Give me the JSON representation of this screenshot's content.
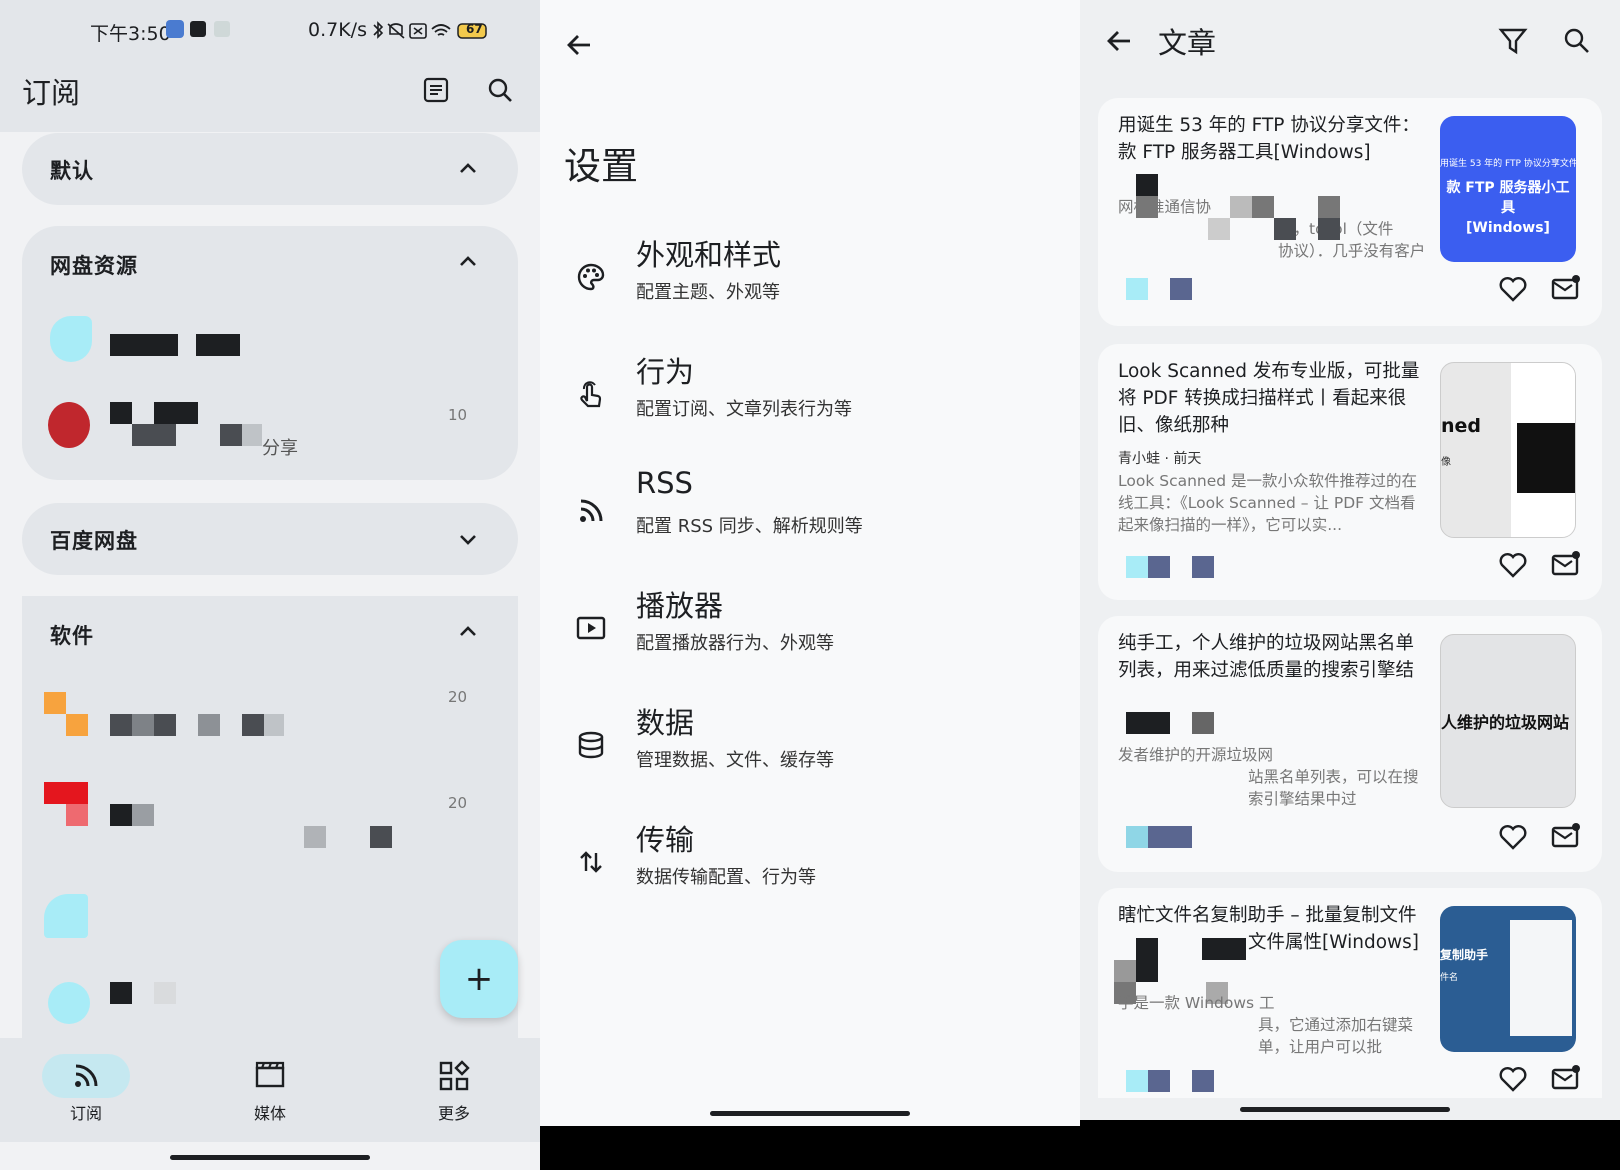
{
  "screen1": {
    "status": {
      "time": "下午3:50",
      "net_speed": "0.7K/s",
      "battery": "67"
    },
    "title": "订阅",
    "groups": [
      {
        "label": "默认"
      },
      {
        "label": "网盘资源",
        "items": [
          {
            "count": ""
          },
          {
            "suffix": "分享",
            "count": "10"
          }
        ]
      },
      {
        "label": "百度网盘"
      },
      {
        "label": "软件",
        "items": [
          {
            "count": "20"
          },
          {
            "count": "20"
          }
        ]
      }
    ],
    "fab_label": "+",
    "nav": [
      {
        "label": "订阅"
      },
      {
        "label": "媒体"
      },
      {
        "label": "更多"
      }
    ]
  },
  "screen2": {
    "title": "设置",
    "items": [
      {
        "title": "外观和样式",
        "subtitle": "配置主题、外观等",
        "icon": "palette-icon"
      },
      {
        "title": "行为",
        "subtitle": "配置订阅、文章列表行为等",
        "icon": "touch-icon"
      },
      {
        "title": "RSS",
        "subtitle": "配置 RSS 同步、解析规则等",
        "icon": "rss-icon"
      },
      {
        "title": "播放器",
        "subtitle": "配置播放器行为、外观等",
        "icon": "play-icon"
      },
      {
        "title": "数据",
        "subtitle": "管理数据、文件、缓存等",
        "icon": "database-icon"
      },
      {
        "title": "传输",
        "subtitle": "数据传输配置、行为等",
        "icon": "transfer-icon"
      }
    ]
  },
  "screen3": {
    "title": "文章",
    "cards": [
      {
        "title": "用诞生 53 年的 FTP 协议分享文件：\n款 FTP 服务器工具[Windows]",
        "meta": "",
        "desc": "网标准通信协\n议，tocol（文件\n协议）．几乎没有客户端不支持。...",
        "thumb_small": "用诞生 53 年的 FTP 协议分享文件",
        "thumb_big": "款 FTP 服务器小工具\n[Windows]"
      },
      {
        "title": "Look Scanned 发布专业版，可批量将 PDF 转换成扫描样式丨看起来很旧、像纸那种",
        "meta": "青小蛙 · 前天",
        "desc": "Look Scanned 是一款小众软件推荐过的在线工具：《Look Scanned – 让 PDF 文档看起来像扫描的一样》，它可以实...",
        "thumb_big": "ned",
        "thumb_small": "像"
      },
      {
        "title": "纯手工，个人维护的垃圾网站黑名单列表，用来过滤低质量的搜索引擎结",
        "meta": "",
        "desc": "发者维护的开源垃圾网\n站黑名单列表，可以在搜索引擎结果中过\n滤掉。@Appinn 当你使用搜索引擎，...",
        "thumb_big": "人维护的垃圾网站"
      },
      {
        "title": "瞎忙文件名复制助手 – 批量复制文件\n文件属性[Windows]",
        "meta": "",
        "desc": "手是一款 Windows 工\n具，它通过添加右键菜单，让用户可以批\n量复制文件名、路径，甚至还能批量复...",
        "thumb_big": "复制助手",
        "thumb_small": "件名"
      }
    ]
  },
  "colors": {
    "accent": "#a8ecf7",
    "surface": "#e3e6ea",
    "background": "#f1f2f4",
    "thumb_blue": "#3b5ef0"
  }
}
